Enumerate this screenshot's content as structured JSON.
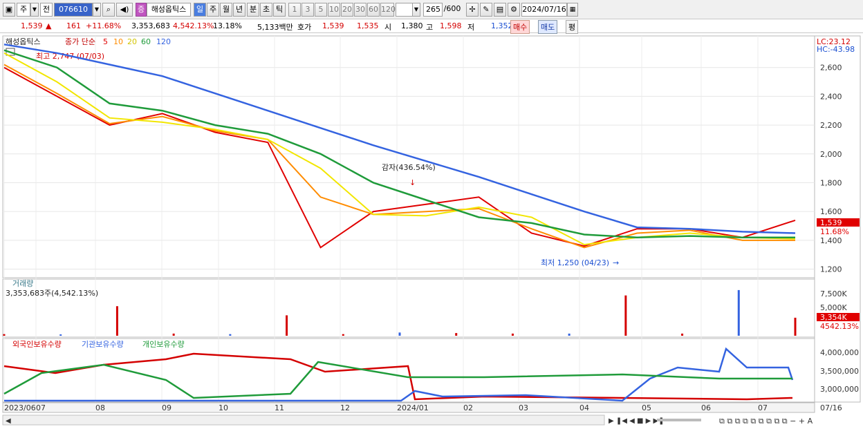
{
  "toolbar": {
    "market": "주",
    "prev": "전",
    "code": "076610",
    "stock_name": "해성옵틱스",
    "periods": [
      "일",
      "주",
      "월",
      "년",
      "분",
      "초",
      "틱"
    ],
    "counts": [
      "1",
      "3",
      "5",
      "10",
      "20",
      "30",
      "60",
      "120"
    ],
    "range": "265",
    "range_total": "/600",
    "date": "2024/07/16"
  },
  "quote": {
    "price": "1,539",
    "change": "161",
    "change_pct": "+11.68%",
    "volume": "3,353,683",
    "volume_pct": "4,542.13%",
    "turnover": "13.18%",
    "amount": "5,133백만",
    "bid_label": "호가",
    "bid": "1,539",
    "ask": "1,535",
    "open_label": "시",
    "open": "1,380",
    "high_label": "고",
    "high": "1,598",
    "low_label": "저",
    "low": "1,352",
    "buy": "매수",
    "sell": "매도",
    "eval": "평"
  },
  "price_panel": {
    "legend_name": "해성옵틱스",
    "legend_ma": "종가 단순",
    "ma_periods": [
      "5",
      "10",
      "20",
      "60",
      "120"
    ],
    "ma_colors": [
      "#e00000",
      "#ff8c00",
      "#f2e600",
      "#1f9b3a",
      "#3463e0"
    ],
    "lc": "LC:23.12",
    "hc": "HC:-43.98",
    "high_note": "최고 2,747 (07/03)",
    "low_note": "최저 1,250 (04/23)",
    "event_note": "감자(436.54%)",
    "last_price": "1,539",
    "last_pct": "11.68%",
    "y_ticks": [
      "2,600",
      "2,400",
      "2,200",
      "2,000",
      "1,800",
      "1,600",
      "1,400",
      "1,200"
    ]
  },
  "volume_panel": {
    "title": "거래량",
    "value": "3,353,683주(4,542.13%)",
    "y_ticks": [
      "7,500K",
      "5,000K"
    ],
    "last": "3,354K",
    "last_pct": "4542.13%"
  },
  "holding_panel": {
    "legend": [
      "외국인보유수량",
      "기관보유수량",
      "개인보유수량"
    ],
    "colors": [
      "#d40000",
      "#3463e0",
      "#1f9b3a"
    ],
    "y_ticks": [
      "4,000,000",
      "3,500,000",
      "3,000,000"
    ]
  },
  "x_axis": {
    "labels": [
      "2023/06",
      "07",
      "08",
      "09",
      "10",
      "11",
      "12",
      "2024/01",
      "02",
      "03",
      "04",
      "05",
      "06",
      "07"
    ],
    "right_label": "07/16"
  },
  "chart_data": {
    "type": "line",
    "ylim": [
      1150,
      2800
    ],
    "x": [
      "2023/06",
      "2023/07",
      "2023/08",
      "2023/09",
      "2023/10",
      "2023/11",
      "2023/11",
      "2023/12",
      "2024/01",
      "2024/02",
      "2024/03",
      "2024/04",
      "2024/05",
      "2024/06",
      "2024/07",
      "2024/07/16"
    ],
    "series": [
      {
        "values": [
          2600,
          2400,
          2200,
          2280,
          2150,
          2080,
          1350,
          1600,
          1650,
          1700,
          1450,
          1360,
          1480,
          1480,
          1420,
          1539
        ]
      },
      {
        "values": [
          2620,
          2420,
          2210,
          2260,
          2160,
          2100,
          1700,
          1580,
          1600,
          1620,
          1480,
          1350,
          1450,
          1470,
          1400,
          1400
        ]
      },
      {
        "values": [
          2700,
          2500,
          2250,
          2220,
          2170,
          2100,
          1900,
          1580,
          1570,
          1630,
          1560,
          1370,
          1420,
          1450,
          1420,
          1410
        ]
      },
      {
        "values": [
          2720,
          2600,
          2350,
          2300,
          2200,
          2140,
          2000,
          1800,
          1680,
          1560,
          1520,
          1440,
          1420,
          1430,
          1420,
          1420
        ]
      },
      {
        "values": [
          2760,
          2700,
          2620,
          2540,
          2420,
          2300,
          2180,
          2060,
          1950,
          1840,
          1720,
          1600,
          1490,
          1480,
          1460,
          1450
        ]
      }
    ],
    "volume": {
      "values": [
        300,
        250,
        5500,
        400,
        300,
        3800,
        300,
        600,
        500,
        400,
        400,
        7500,
        400,
        8500,
        3354
      ],
      "ylim": [
        0,
        9000
      ]
    }
  }
}
